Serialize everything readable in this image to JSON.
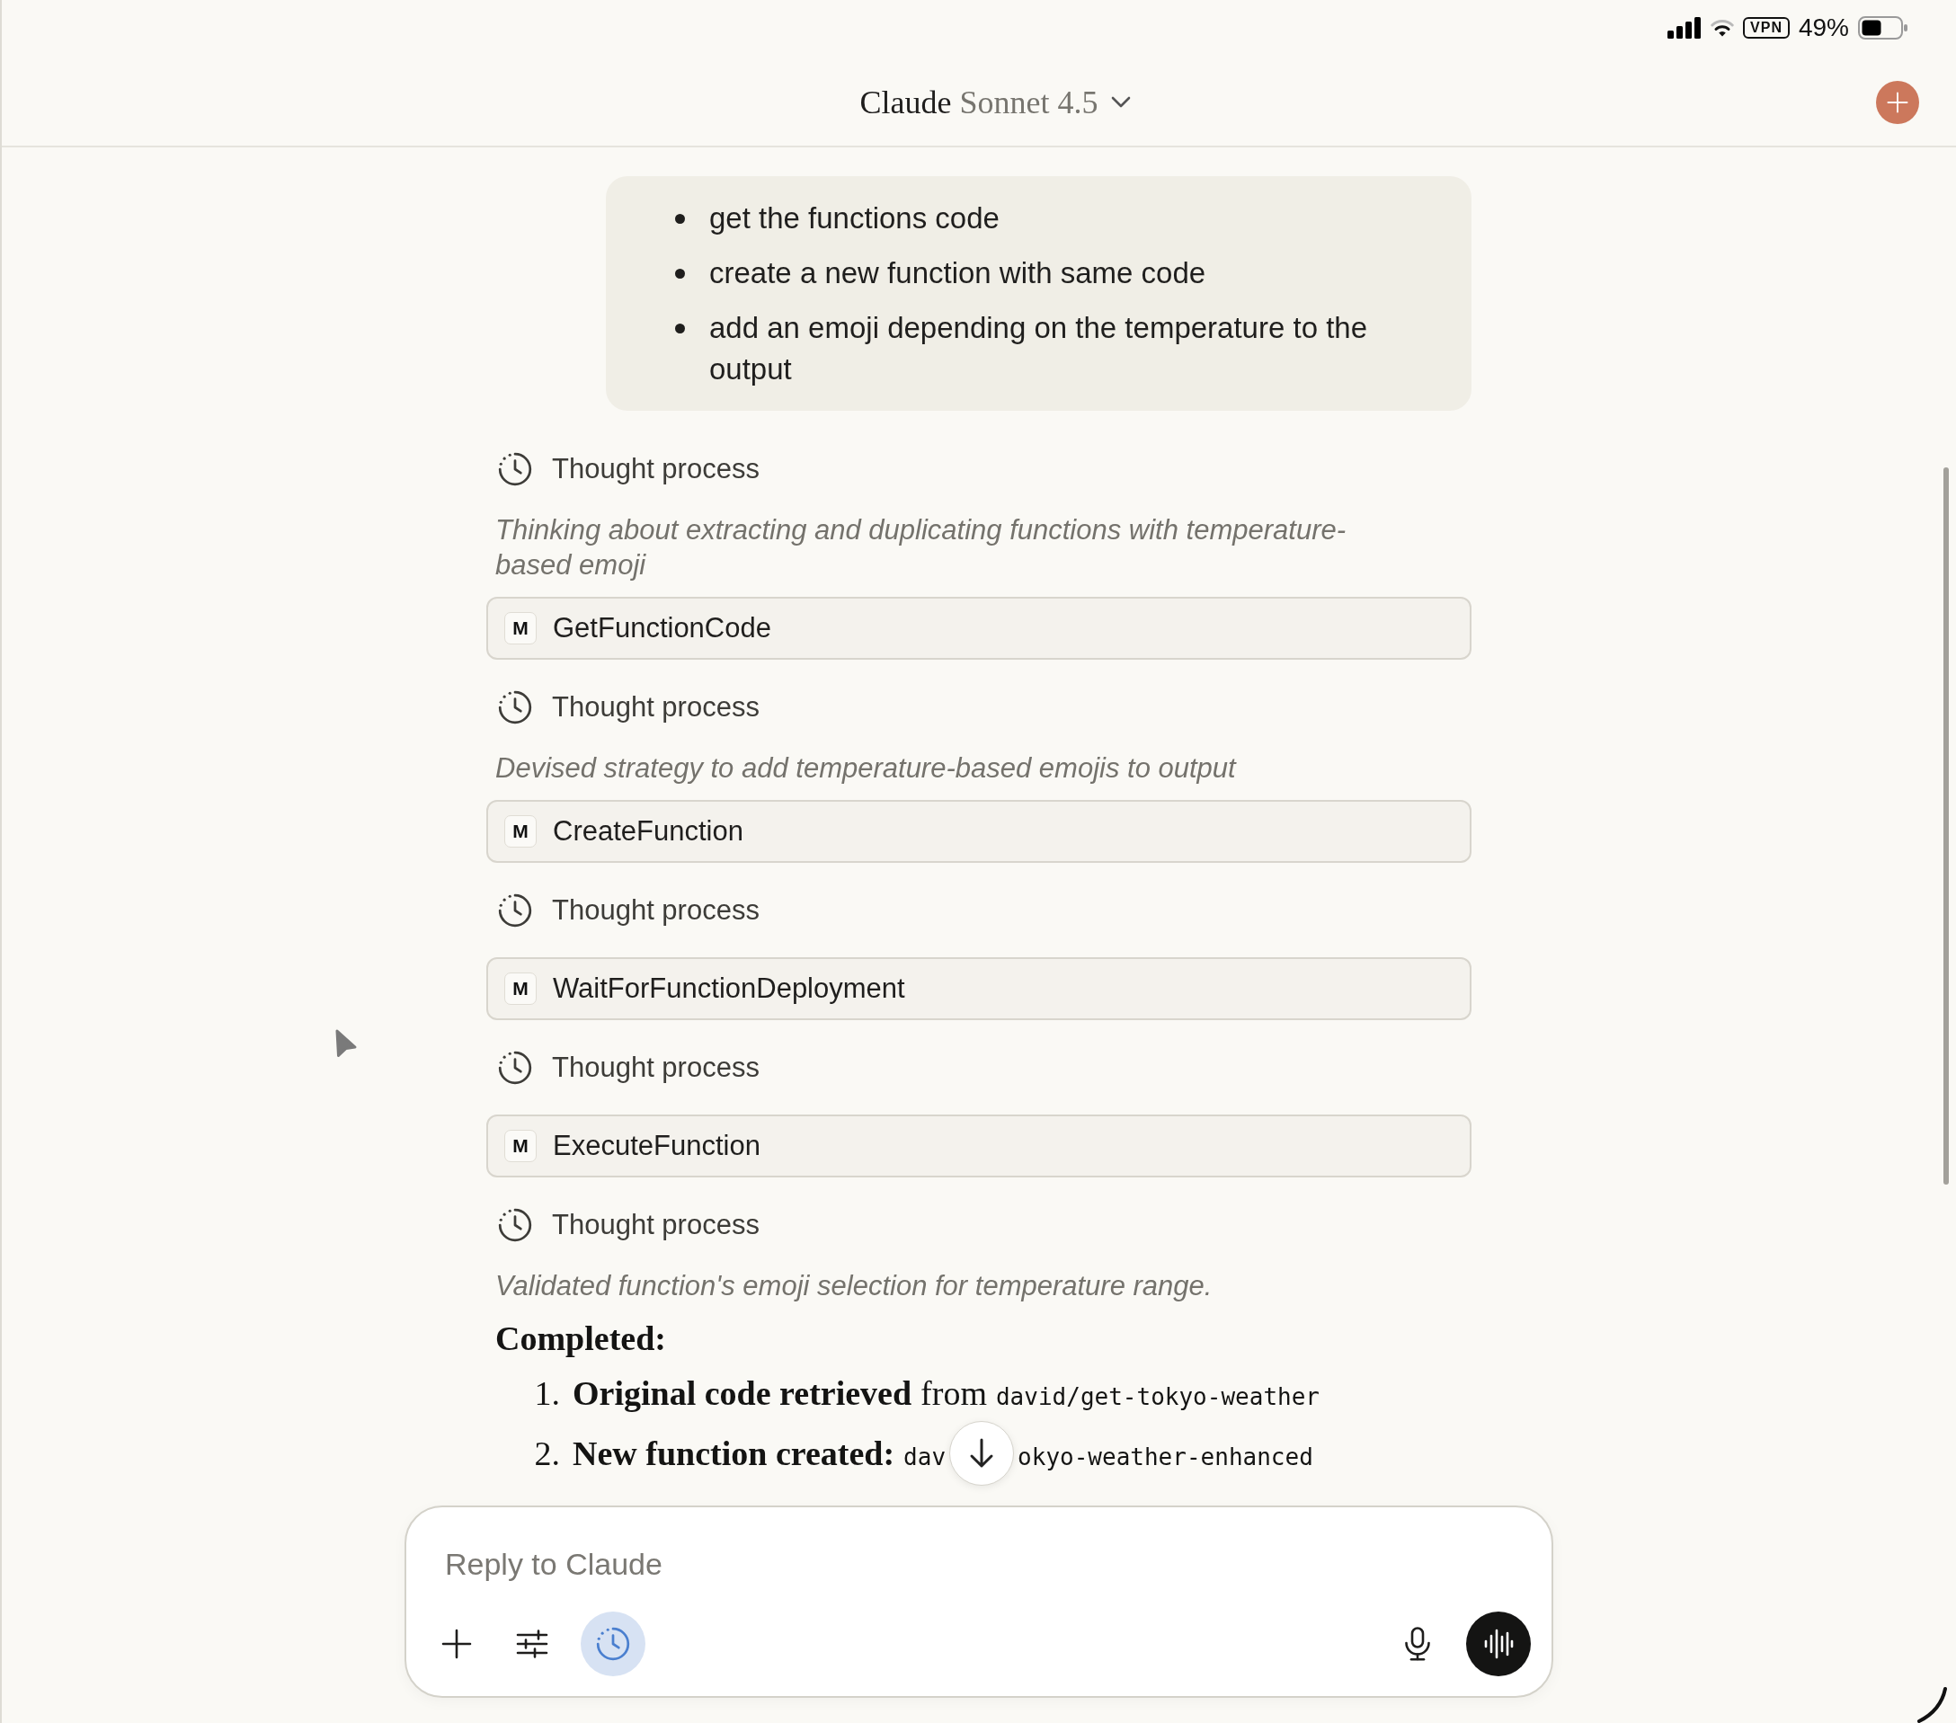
{
  "status_bar": {
    "vpn": "VPN",
    "battery": "49%"
  },
  "header": {
    "title": "Claude",
    "model": "Sonnet 4.5"
  },
  "user_message": {
    "bullets": [
      "get the functions code",
      "create a new function with same code",
      "add an emoji depending on the temperature to the output"
    ]
  },
  "transcript": [
    {
      "kind": "thought",
      "label": "Thought process",
      "summary": "Thinking about extracting and duplicating functions with temperature-based emoji"
    },
    {
      "kind": "tool",
      "badge": "M",
      "name": "GetFunctionCode"
    },
    {
      "kind": "thought",
      "label": "Thought process",
      "summary": "Devised strategy to add temperature-based emojis to output"
    },
    {
      "kind": "tool",
      "badge": "M",
      "name": "CreateFunction"
    },
    {
      "kind": "thought",
      "label": "Thought process"
    },
    {
      "kind": "tool",
      "badge": "M",
      "name": "WaitForFunctionDeployment"
    },
    {
      "kind": "thought",
      "label": "Thought process"
    },
    {
      "kind": "tool",
      "badge": "M",
      "name": "ExecuteFunction"
    },
    {
      "kind": "thought",
      "label": "Thought process",
      "summary": "Validated function's emoji selection for temperature range."
    }
  ],
  "result": {
    "heading": "Completed:",
    "items": [
      {
        "number": "1.",
        "title": "Original code retrieved",
        "text": "from",
        "code": "david/get-tokyo-weather"
      },
      {
        "number": "2.",
        "title": "New function created:",
        "code": "dav",
        "code_continued": "okyo-weather-enhanced"
      }
    ]
  },
  "composer": {
    "placeholder": "Reply to Claude",
    "thinking_toggle": {
      "on": true
    }
  }
}
